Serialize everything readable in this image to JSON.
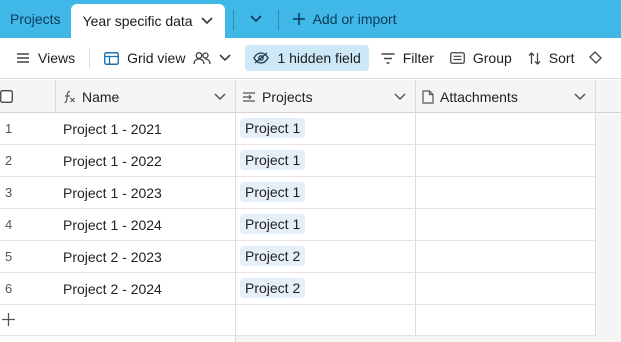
{
  "tabs": {
    "base_tab": "Projects",
    "active_tab": "Year specific data",
    "add_label": "Add or import"
  },
  "toolbar": {
    "views_label": "Views",
    "grid_view_label": "Grid view",
    "hidden_fields_label": "1 hidden field",
    "filter_label": "Filter",
    "group_label": "Group",
    "sort_label": "Sort"
  },
  "table": {
    "columns": [
      "Name",
      "Projects",
      "Attachments"
    ],
    "rows": [
      {
        "num": "1",
        "name": "Project 1 - 2021",
        "project": "Project 1"
      },
      {
        "num": "2",
        "name": "Project 1 - 2022",
        "project": "Project 1"
      },
      {
        "num": "3",
        "name": "Project 1 - 2023",
        "project": "Project 1"
      },
      {
        "num": "4",
        "name": "Project 1 - 2024",
        "project": "Project 1"
      },
      {
        "num": "5",
        "name": "Project 2 - 2023",
        "project": "Project 2"
      },
      {
        "num": "6",
        "name": "Project 2 - 2024",
        "project": "Project 2"
      }
    ]
  },
  "colors": {
    "tabbar_bg": "#3fb8e8",
    "hidden_field_bg": "#cde8f7",
    "chip_bg": "#e6eef8"
  }
}
